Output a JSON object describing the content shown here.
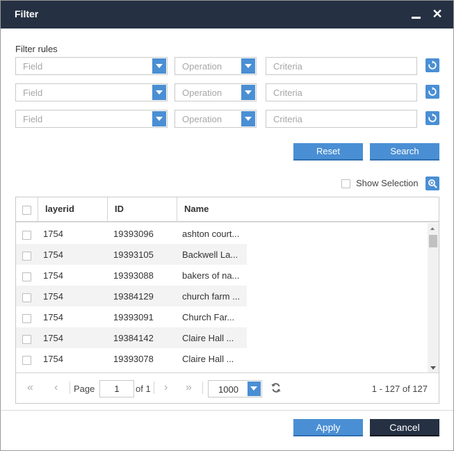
{
  "window": {
    "title": "Filter",
    "minimize_icon": "minimize-icon",
    "close_icon": "close-icon"
  },
  "filter": {
    "label": "Filter rules",
    "rows": [
      {
        "field_placeholder": "Field",
        "operation_placeholder": "Operation",
        "criteria_placeholder": "Criteria"
      },
      {
        "field_placeholder": "Field",
        "operation_placeholder": "Operation",
        "criteria_placeholder": "Criteria"
      },
      {
        "field_placeholder": "Field",
        "operation_placeholder": "Operation",
        "criteria_placeholder": "Criteria"
      }
    ],
    "reset_label": "Reset",
    "search_label": "Search"
  },
  "selection": {
    "show_selection_label": "Show Selection",
    "show_selection_checked": false
  },
  "grid": {
    "columns": [
      "layerid",
      "ID",
      "Name"
    ],
    "rows": [
      {
        "layerid": "1754",
        "id": "19393096",
        "name": "ashton court..."
      },
      {
        "layerid": "1754",
        "id": "19393105",
        "name": "Backwell La..."
      },
      {
        "layerid": "1754",
        "id": "19393088",
        "name": "bakers of na..."
      },
      {
        "layerid": "1754",
        "id": "19384129",
        "name": "church farm ..."
      },
      {
        "layerid": "1754",
        "id": "19393091",
        "name": "Church Far..."
      },
      {
        "layerid": "1754",
        "id": "19384142",
        "name": "Claire Hall ..."
      },
      {
        "layerid": "1754",
        "id": "19393078",
        "name": "Claire Hall ..."
      }
    ]
  },
  "pager": {
    "page_label": "Page",
    "page_value": "1",
    "of_label": "of 1",
    "page_size": "1000",
    "count_label": "1 - 127 of 127"
  },
  "footer": {
    "apply_label": "Apply",
    "cancel_label": "Cancel"
  },
  "colors": {
    "titlebar": "#253143",
    "accent": "#4a8fd4",
    "cancel": "#253143"
  }
}
